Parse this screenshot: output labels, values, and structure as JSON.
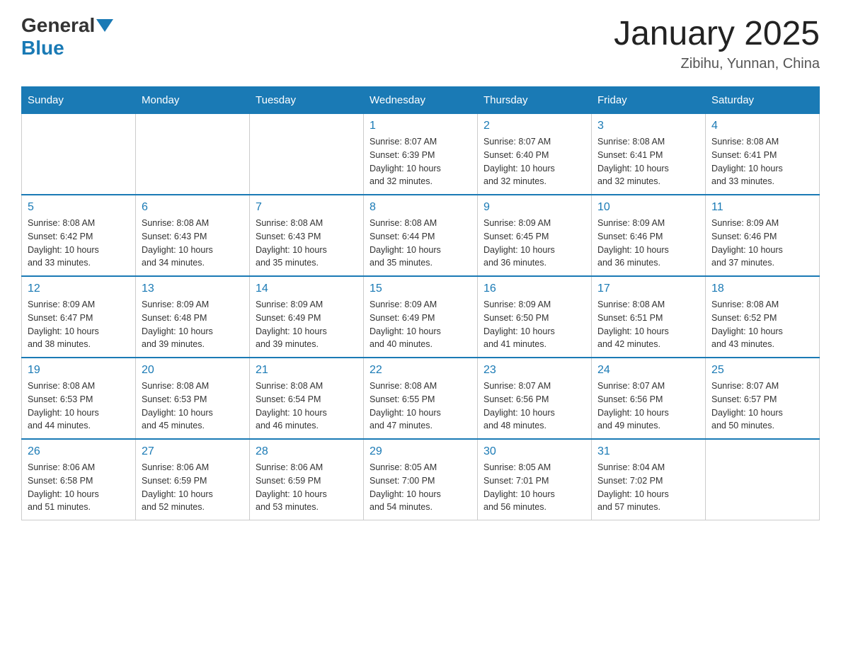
{
  "header": {
    "logo_general": "General",
    "logo_blue": "Blue",
    "month_title": "January 2025",
    "location": "Zibihu, Yunnan, China"
  },
  "days_of_week": [
    "Sunday",
    "Monday",
    "Tuesday",
    "Wednesday",
    "Thursday",
    "Friday",
    "Saturday"
  ],
  "weeks": [
    [
      {
        "day": "",
        "info": ""
      },
      {
        "day": "",
        "info": ""
      },
      {
        "day": "",
        "info": ""
      },
      {
        "day": "1",
        "info": "Sunrise: 8:07 AM\nSunset: 6:39 PM\nDaylight: 10 hours\nand 32 minutes."
      },
      {
        "day": "2",
        "info": "Sunrise: 8:07 AM\nSunset: 6:40 PM\nDaylight: 10 hours\nand 32 minutes."
      },
      {
        "day": "3",
        "info": "Sunrise: 8:08 AM\nSunset: 6:41 PM\nDaylight: 10 hours\nand 32 minutes."
      },
      {
        "day": "4",
        "info": "Sunrise: 8:08 AM\nSunset: 6:41 PM\nDaylight: 10 hours\nand 33 minutes."
      }
    ],
    [
      {
        "day": "5",
        "info": "Sunrise: 8:08 AM\nSunset: 6:42 PM\nDaylight: 10 hours\nand 33 minutes."
      },
      {
        "day": "6",
        "info": "Sunrise: 8:08 AM\nSunset: 6:43 PM\nDaylight: 10 hours\nand 34 minutes."
      },
      {
        "day": "7",
        "info": "Sunrise: 8:08 AM\nSunset: 6:43 PM\nDaylight: 10 hours\nand 35 minutes."
      },
      {
        "day": "8",
        "info": "Sunrise: 8:08 AM\nSunset: 6:44 PM\nDaylight: 10 hours\nand 35 minutes."
      },
      {
        "day": "9",
        "info": "Sunrise: 8:09 AM\nSunset: 6:45 PM\nDaylight: 10 hours\nand 36 minutes."
      },
      {
        "day": "10",
        "info": "Sunrise: 8:09 AM\nSunset: 6:46 PM\nDaylight: 10 hours\nand 36 minutes."
      },
      {
        "day": "11",
        "info": "Sunrise: 8:09 AM\nSunset: 6:46 PM\nDaylight: 10 hours\nand 37 minutes."
      }
    ],
    [
      {
        "day": "12",
        "info": "Sunrise: 8:09 AM\nSunset: 6:47 PM\nDaylight: 10 hours\nand 38 minutes."
      },
      {
        "day": "13",
        "info": "Sunrise: 8:09 AM\nSunset: 6:48 PM\nDaylight: 10 hours\nand 39 minutes."
      },
      {
        "day": "14",
        "info": "Sunrise: 8:09 AM\nSunset: 6:49 PM\nDaylight: 10 hours\nand 39 minutes."
      },
      {
        "day": "15",
        "info": "Sunrise: 8:09 AM\nSunset: 6:49 PM\nDaylight: 10 hours\nand 40 minutes."
      },
      {
        "day": "16",
        "info": "Sunrise: 8:09 AM\nSunset: 6:50 PM\nDaylight: 10 hours\nand 41 minutes."
      },
      {
        "day": "17",
        "info": "Sunrise: 8:08 AM\nSunset: 6:51 PM\nDaylight: 10 hours\nand 42 minutes."
      },
      {
        "day": "18",
        "info": "Sunrise: 8:08 AM\nSunset: 6:52 PM\nDaylight: 10 hours\nand 43 minutes."
      }
    ],
    [
      {
        "day": "19",
        "info": "Sunrise: 8:08 AM\nSunset: 6:53 PM\nDaylight: 10 hours\nand 44 minutes."
      },
      {
        "day": "20",
        "info": "Sunrise: 8:08 AM\nSunset: 6:53 PM\nDaylight: 10 hours\nand 45 minutes."
      },
      {
        "day": "21",
        "info": "Sunrise: 8:08 AM\nSunset: 6:54 PM\nDaylight: 10 hours\nand 46 minutes."
      },
      {
        "day": "22",
        "info": "Sunrise: 8:08 AM\nSunset: 6:55 PM\nDaylight: 10 hours\nand 47 minutes."
      },
      {
        "day": "23",
        "info": "Sunrise: 8:07 AM\nSunset: 6:56 PM\nDaylight: 10 hours\nand 48 minutes."
      },
      {
        "day": "24",
        "info": "Sunrise: 8:07 AM\nSunset: 6:56 PM\nDaylight: 10 hours\nand 49 minutes."
      },
      {
        "day": "25",
        "info": "Sunrise: 8:07 AM\nSunset: 6:57 PM\nDaylight: 10 hours\nand 50 minutes."
      }
    ],
    [
      {
        "day": "26",
        "info": "Sunrise: 8:06 AM\nSunset: 6:58 PM\nDaylight: 10 hours\nand 51 minutes."
      },
      {
        "day": "27",
        "info": "Sunrise: 8:06 AM\nSunset: 6:59 PM\nDaylight: 10 hours\nand 52 minutes."
      },
      {
        "day": "28",
        "info": "Sunrise: 8:06 AM\nSunset: 6:59 PM\nDaylight: 10 hours\nand 53 minutes."
      },
      {
        "day": "29",
        "info": "Sunrise: 8:05 AM\nSunset: 7:00 PM\nDaylight: 10 hours\nand 54 minutes."
      },
      {
        "day": "30",
        "info": "Sunrise: 8:05 AM\nSunset: 7:01 PM\nDaylight: 10 hours\nand 56 minutes."
      },
      {
        "day": "31",
        "info": "Sunrise: 8:04 AM\nSunset: 7:02 PM\nDaylight: 10 hours\nand 57 minutes."
      },
      {
        "day": "",
        "info": ""
      }
    ]
  ]
}
